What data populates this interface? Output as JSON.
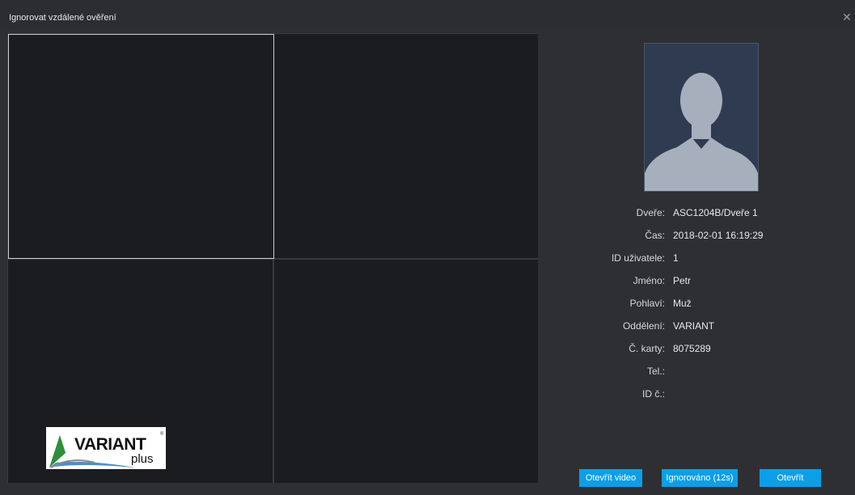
{
  "dialog": {
    "title": "Ignorovat vzdálené ověření",
    "close_glyph": "✕"
  },
  "logo": {
    "brand": "VARIANT",
    "sub": "plus",
    "reg_mark": "®"
  },
  "info": {
    "rows": [
      {
        "label": "Dveře:",
        "value": "ASC1204B/Dveře 1"
      },
      {
        "label": "Čas:",
        "value": "2018-02-01 16:19:29"
      },
      {
        "label": "ID uživatele:",
        "value": "1"
      },
      {
        "label": "Jméno:",
        "value": "Petr"
      },
      {
        "label": "Pohlaví:",
        "value": "Muž"
      },
      {
        "label": "Oddělení:",
        "value": "VARIANT"
      },
      {
        "label": "Č. karty:",
        "value": "8075289"
      },
      {
        "label": "Tel.:",
        "value": ""
      },
      {
        "label": "ID č.:",
        "value": ""
      }
    ]
  },
  "buttons": {
    "open_video": "Otevřít video",
    "ignored": "Ignorováno (12s)",
    "open": "Otevřít"
  },
  "icons": {
    "close": "close-icon",
    "avatar": "user-silhouette-icon"
  },
  "colors": {
    "button_accent": "#0a9fe8",
    "background": "#2d2f33",
    "video_pane": "#1b1c1f"
  }
}
